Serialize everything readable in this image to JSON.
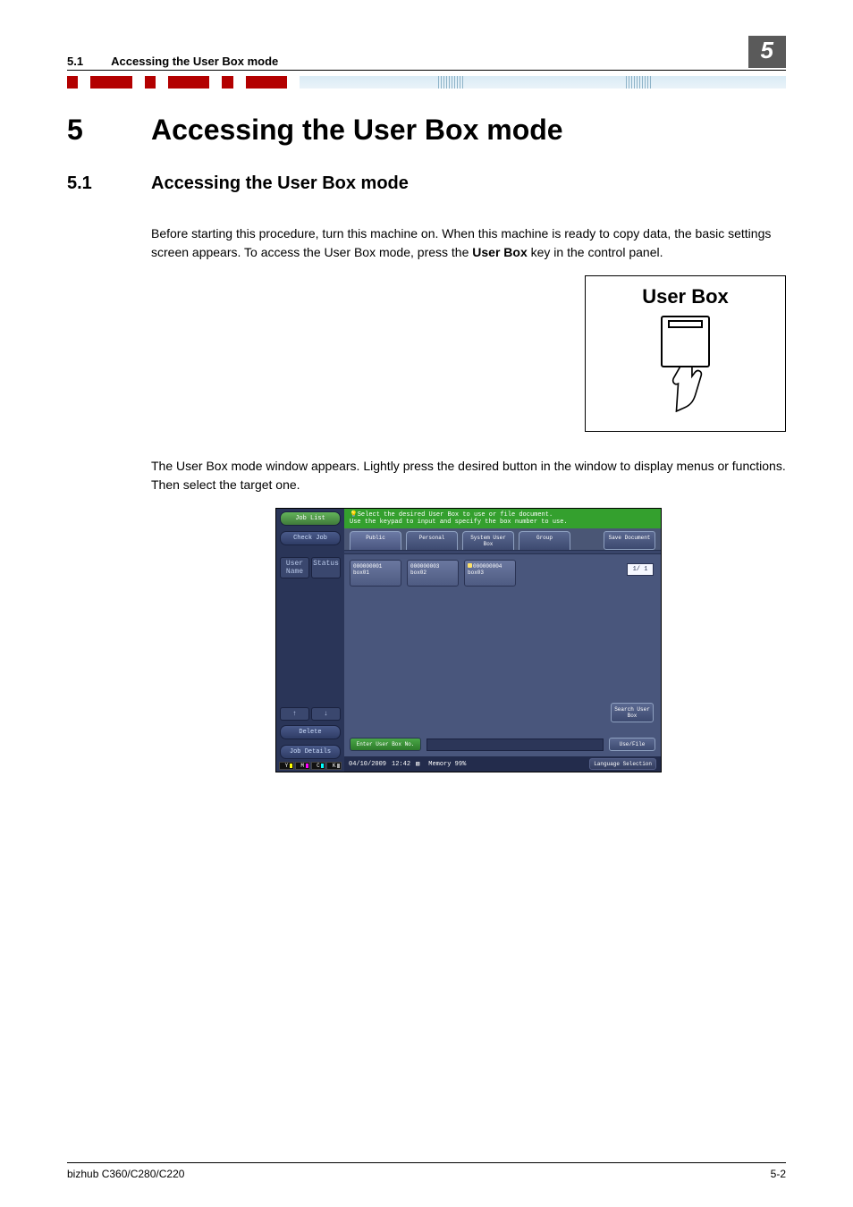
{
  "header": {
    "section_number": "5.1",
    "section_title": "Accessing the User Box mode",
    "chapter_badge": "5"
  },
  "chapter": {
    "number": "5",
    "title": "Accessing the User Box mode"
  },
  "section": {
    "number": "5.1",
    "title": "Accessing the User Box mode"
  },
  "paragraphs": {
    "p1_a": "Before starting this procedure, turn this machine on. When this machine is ready to copy data, the basic settings screen appears. To access the User Box mode, press the ",
    "p1_bold": "User Box",
    "p1_b": " key in the control panel.",
    "p2": "The User Box mode window appears. Lightly press the desired button in the window to display menus or functions. Then select the target one."
  },
  "figure1": {
    "title": "User Box"
  },
  "screen": {
    "instruction_line1": "Select the desired User Box to use or file document.",
    "instruction_line2": "Use the keypad to input and specify the box number to use.",
    "left_panel": {
      "job_list": "Job List",
      "check_job": "Check Job",
      "user_name": "User Name",
      "status": "Status",
      "delete": "Delete",
      "job_details": "Job Details",
      "toner_y": "Y",
      "toner_m": "M",
      "toner_c": "C",
      "toner_k": "K"
    },
    "tabs": {
      "public": "Public",
      "personal": "Personal",
      "system": "System User Box",
      "group": "Group"
    },
    "save_document": "Save Document",
    "boxes": [
      {
        "number": "000000001",
        "name": "box01"
      },
      {
        "number": "000000003",
        "name": "box02"
      },
      {
        "number": "000000004",
        "name": "box03"
      }
    ],
    "page_indicator": "1/ 1",
    "search_user_box": "Search User Box",
    "enter_label": "Enter User Box No.",
    "use_file": "Use/File",
    "status_bar": {
      "date": "04/10/2009",
      "time": "12:42",
      "memory_label": "Memory",
      "memory_value": "99%",
      "language": "Language Selection"
    }
  },
  "footer": {
    "model": "bizhub C360/C280/C220",
    "page": "5-2"
  }
}
